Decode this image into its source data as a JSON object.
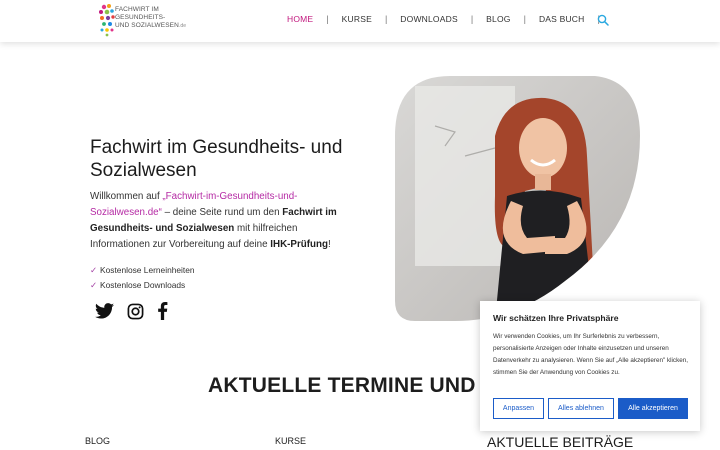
{
  "header": {
    "logo_line1": "FACHWIRT IM GESUNDHEITS-",
    "logo_line2": "UND SOZIALWESEN",
    "logo_domain": ".de",
    "nav": [
      {
        "label": "HOME",
        "active": true
      },
      {
        "label": "KURSE"
      },
      {
        "label": "DOWNLOADS"
      },
      {
        "label": "BLOG"
      },
      {
        "label": "DAS BUCH"
      }
    ],
    "separator": "|"
  },
  "hero": {
    "title": "Fachwirt im Gesundheits- und Sozialwesen",
    "intro_before_link": "Willkommen auf ",
    "intro_link": "„Fachwirt-im-Gesundheits-und-Sozialwesen.de“",
    "intro_mid": " – deine Seite rund um den ",
    "intro_bold1": "Fachwirt im Gesundheits- und Sozialwesen",
    "intro_mid2": " mit hilfreichen Informationen zur Vorbereitung auf deine ",
    "intro_bold2": "IHK-Prüfung",
    "intro_end": "!",
    "checks": [
      "Kostenlose Lerneinheiten",
      "Kostenlose Downloads"
    ],
    "check_mark": "✓"
  },
  "social": [
    "twitter-icon",
    "instagram-icon",
    "facebook-icon"
  ],
  "section_title": "AKTUELLE TERMINE UND NE",
  "columns": {
    "blog": "BLOG",
    "kurse": "KURSE",
    "beitraege": "AKTUELLE BEITRÄGE"
  },
  "cookie": {
    "title": "Wir schätzen Ihre Privatsphäre",
    "text": "Wir verwenden Cookies, um Ihr Surferlebnis zu verbessern, personalisierte Anzeigen oder Inhalte einzusetzen und unseren Datenverkehr zu analysieren. Wenn Sie auf „Alle akzeptieren\" klicken, stimmen Sie der Anwendung von Cookies zu.",
    "btn_customize": "Anpassen",
    "btn_reject": "Alles ablehnen",
    "btn_accept": "Alle akzeptieren"
  },
  "colors": {
    "accent_pink": "#c2187e",
    "link_purple": "#b52aa4",
    "button_blue": "#1b5cc8"
  }
}
